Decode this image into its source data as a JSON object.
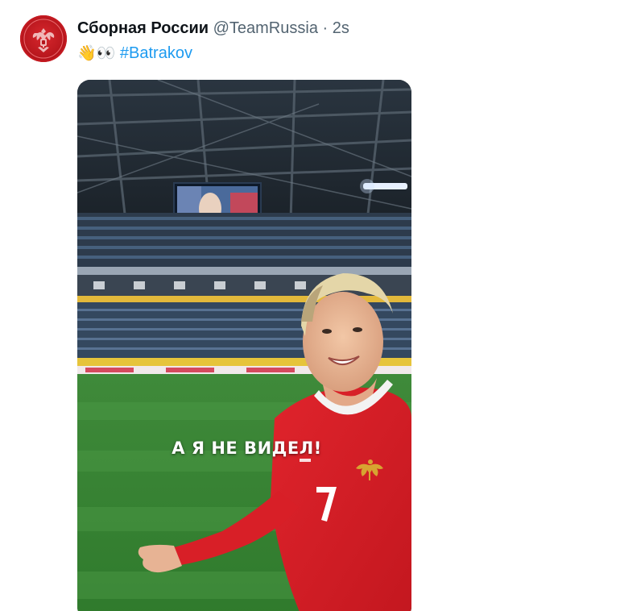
{
  "tweet": {
    "author": {
      "display_name": "Сборная России",
      "handle": "@TeamRussia",
      "separator": "·",
      "time": "2s",
      "avatar_icon": "russia-eagle-crest-icon",
      "avatar_color": "#c41a21"
    },
    "text": {
      "emojis": "👋👀",
      "hashtag": "#Batrakov"
    },
    "media": {
      "type": "video-frame",
      "caption": "А Я НЕ ВИДЕЛ!",
      "player_number": "7"
    }
  },
  "colors": {
    "link": "#1d9bf0",
    "secondary_text": "#536471",
    "primary_text": "#0f1419"
  }
}
